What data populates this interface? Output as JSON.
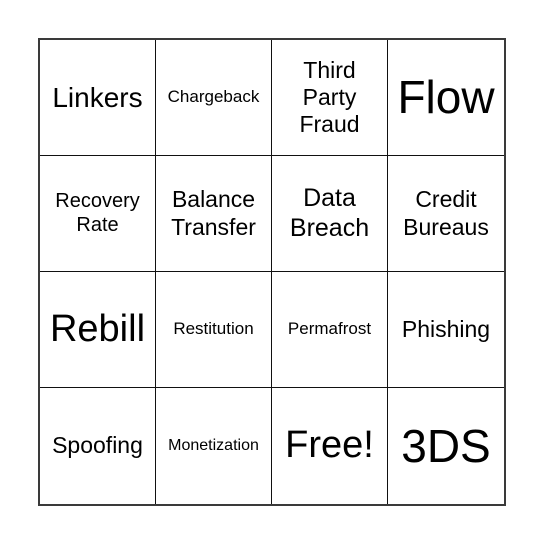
{
  "board": {
    "cells": [
      {
        "text": "Linkers",
        "size": "m"
      },
      {
        "text": "Chargeback",
        "size": "xs"
      },
      {
        "text": "Third Party Fraud",
        "size": "mm"
      },
      {
        "text": "Flow",
        "size": "xl"
      },
      {
        "text": "Recovery Rate",
        "size": "sm"
      },
      {
        "text": "Balance Transfer",
        "size": "mm"
      },
      {
        "text": "Data Breach",
        "size": "ml"
      },
      {
        "text": "Credit Bureaus",
        "size": "mm"
      },
      {
        "text": "Rebill",
        "size": "l"
      },
      {
        "text": "Restitution",
        "size": "xs"
      },
      {
        "text": "Permafrost",
        "size": "xs"
      },
      {
        "text": "Phishing",
        "size": "mm"
      },
      {
        "text": "Spoofing",
        "size": "mm"
      },
      {
        "text": "Monetization",
        "size": "xxs"
      },
      {
        "text": "Free!",
        "size": "l"
      },
      {
        "text": "3DS",
        "size": "xl"
      }
    ]
  }
}
